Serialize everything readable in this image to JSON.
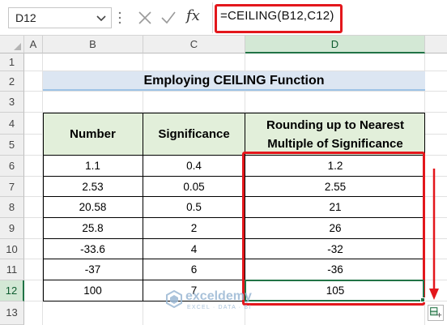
{
  "formula_bar": {
    "name_box": "D12",
    "fx_label": "fx",
    "formula": "=CEILING(B12,C12)"
  },
  "columns": [
    "A",
    "B",
    "C",
    "D"
  ],
  "rows": [
    "1",
    "2",
    "3",
    "4",
    "5",
    "6",
    "7",
    "8",
    "9",
    "10",
    "11",
    "12",
    "13"
  ],
  "title": "Employing CEILING Function",
  "table": {
    "headers": {
      "number": "Number",
      "significance": "Significance",
      "rounding": "Rounding up to Nearest Multiple of Significance"
    },
    "rows": [
      {
        "number": "1.1",
        "significance": "0.4",
        "result": "1.2"
      },
      {
        "number": "2.53",
        "significance": "0.05",
        "result": "2.55"
      },
      {
        "number": "20.58",
        "significance": "0.5",
        "result": "21"
      },
      {
        "number": "25.8",
        "significance": "2",
        "result": "26"
      },
      {
        "number": "-33.6",
        "significance": "4",
        "result": "-32"
      },
      {
        "number": "-37",
        "significance": "6",
        "result": "-36"
      },
      {
        "number": "100",
        "significance": "7",
        "result": "105"
      }
    ]
  },
  "watermark": {
    "name": "exceldemy",
    "tagline": "EXCEL · DATA · BI"
  },
  "colors": {
    "highlight_red": "#e3171c",
    "excel_green": "#217346",
    "title_fill": "#dce6f2",
    "header_fill": "#e2efda"
  },
  "icons": [
    "name-box-dropdown-icon",
    "cancel-icon",
    "enter-icon",
    "fx-icon",
    "autofill-options-icon",
    "exceldemy-logo-icon"
  ]
}
